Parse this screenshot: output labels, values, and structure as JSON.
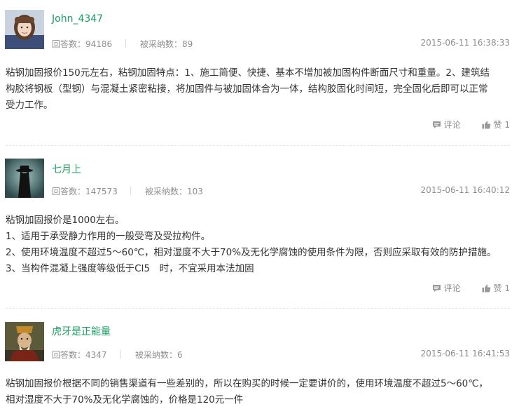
{
  "labels": {
    "answers_prefix": "回答数：",
    "adopted_prefix": "被采纳数：",
    "comment": "评论",
    "like": "赞"
  },
  "answers": [
    {
      "username": "John_4347",
      "answer_count": "94186",
      "adopted_count": "89",
      "time": "2015-06-11 16:38:33",
      "content": [
        "粘钢加固报价150元左右，粘钢加固特点：1、施工简便、快捷、基本不增加被加固构件断面尺寸和重量。2、建筑结",
        "构胶将钢板（型钢）与混凝土紧密粘接，将加固件与被加固体合为一体，结构胶固化时间短，完全固化后即可以正常",
        "受力工作。"
      ],
      "likes": "1"
    },
    {
      "username": "七月上",
      "answer_count": "147573",
      "adopted_count": "103",
      "time": "2015-06-11 16:40:12",
      "content": [
        "粘钢加固报价是1000左右。",
        "1、适用于承受静力作用的一般受弯及受拉构件。",
        "2、使用环境温度不超过5～60℃，相对湿度不大于70%及无化学腐蚀的使用条件为限，否则应采取有效的防护措施。",
        "3、当构件混凝上强度等级低于CI5　时，不宜采用本法加固"
      ],
      "likes": "1"
    },
    {
      "username": "虎牙是正能量",
      "answer_count": "4347",
      "adopted_count": "6",
      "time": "2015-06-11 16:41:53",
      "content": [
        "粘钢加固报价根据不同的销售渠道有一些差别的，所以在购买的时候一定要讲价的，使用环境温度不超过5～60℃，",
        "相对湿度不大于70%及无化学腐蚀的，价格是120元一件"
      ]
    }
  ]
}
